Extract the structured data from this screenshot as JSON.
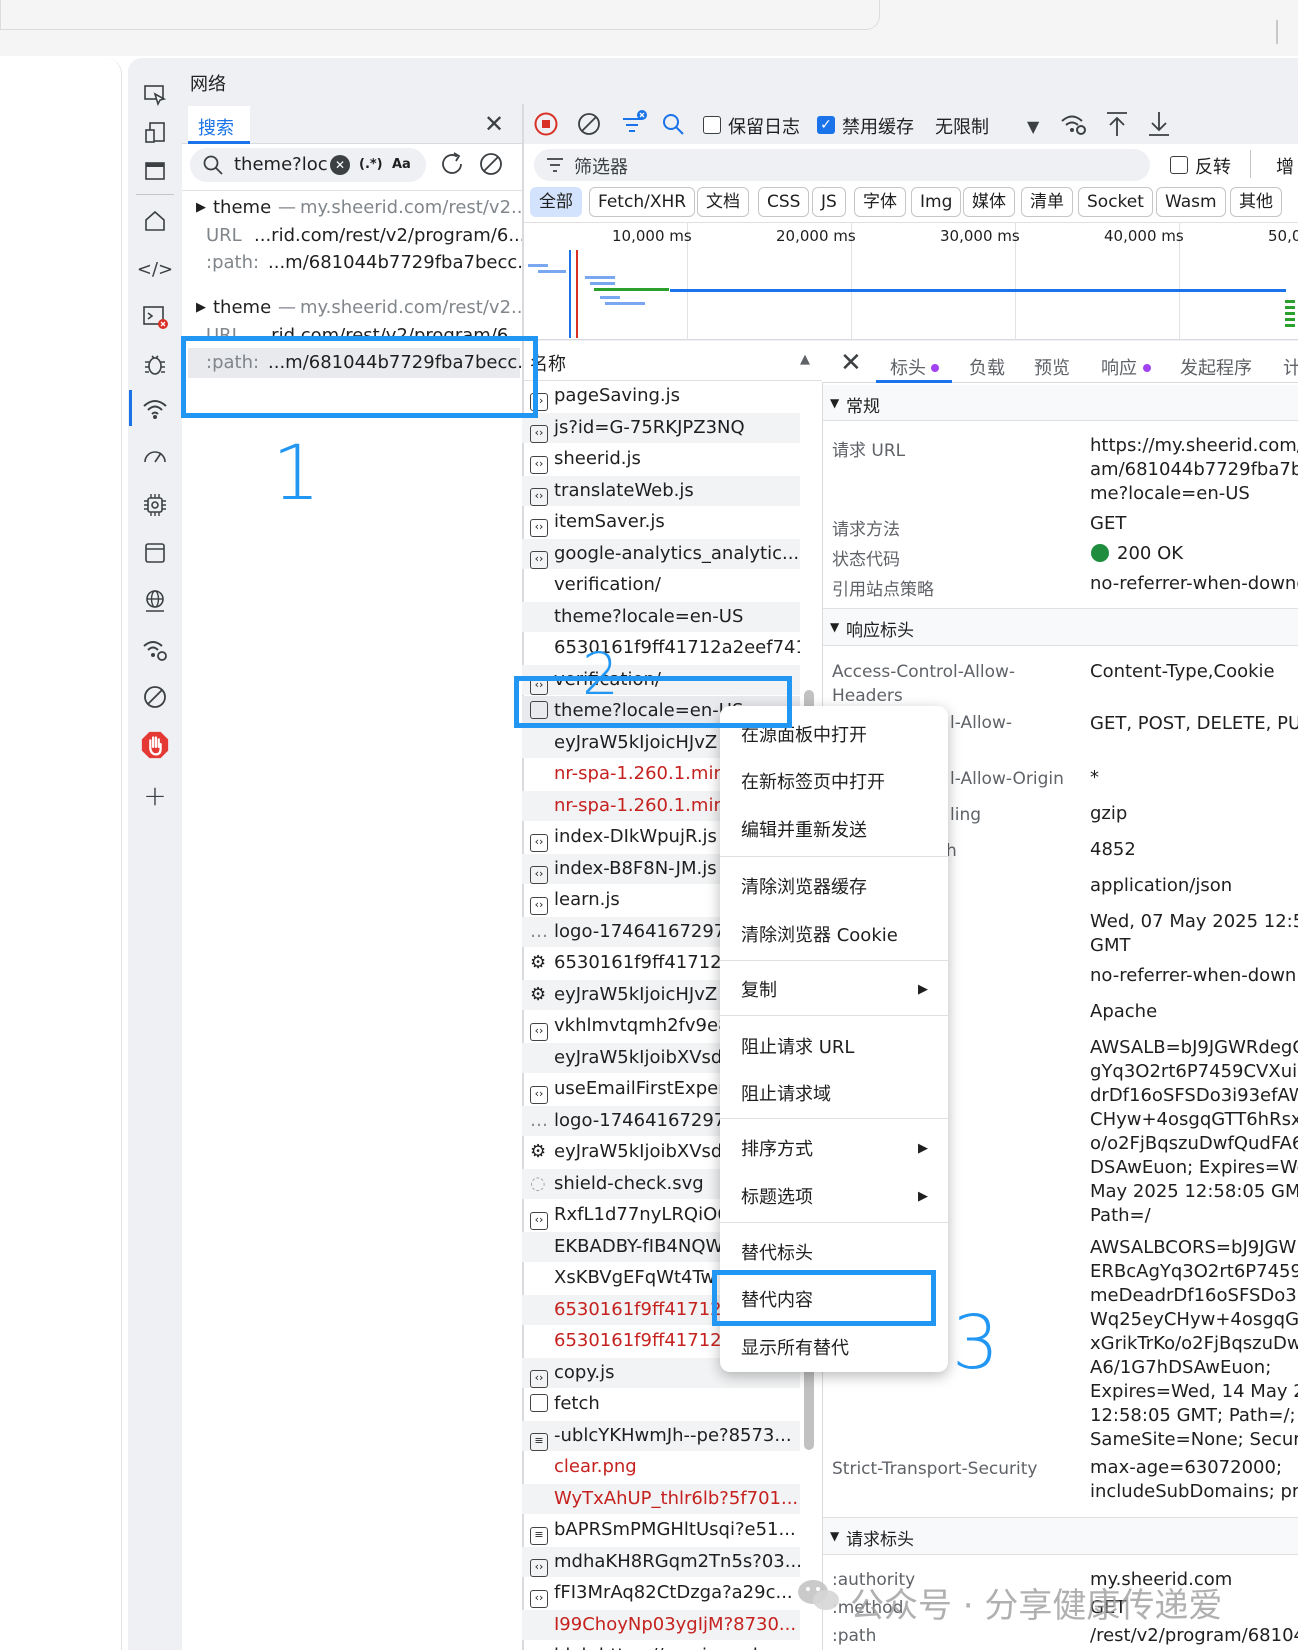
{
  "panel_title": "网络",
  "search": {
    "tab_label": "搜索",
    "query": "theme?loc",
    "regex_label": "(.*)",
    "case_label": "Aa",
    "results": [
      {
        "name": "theme",
        "source": "my.sheerid.com/rest/v2...",
        "url_label": "URL",
        "url_value": "...rid.com/rest/v2/program/6...",
        "path_label": ":path:",
        "path_value": "...m/681044b7729fba7becc..."
      },
      {
        "name": "theme",
        "source": "my.sheerid.com/rest/v2...",
        "url_label": "URL",
        "url_value": "...rid.com/rest/v2/program/6...",
        "path_label": ":path:",
        "path_value": "...m/681044b7729fba7becc..."
      }
    ]
  },
  "toolbar": {
    "preserve_log": "保留日志",
    "disable_cache": "禁用缓存",
    "throttle": "无限制",
    "invert": "反转",
    "more": "增"
  },
  "filter": {
    "placeholder": "筛选器",
    "chips": [
      "全部",
      "Fetch/XHR",
      "文档",
      "CSS",
      "JS",
      "字体",
      "Img",
      "媒体",
      "清单",
      "Socket",
      "Wasm",
      "其他"
    ]
  },
  "timeline": {
    "ticks": [
      "10,000 ms",
      "20,000 ms",
      "30,000 ms",
      "40,000 ms",
      "50,0"
    ]
  },
  "request_list": {
    "header": "名称",
    "rows": [
      {
        "name": "pageSaving.js",
        "color": "normal"
      },
      {
        "name": "js?id=G-75RKJPZ3NQ",
        "color": "normal"
      },
      {
        "name": "sheerid.js",
        "color": "normal"
      },
      {
        "name": "translateWeb.js",
        "color": "normal"
      },
      {
        "name": "itemSaver.js",
        "color": "normal"
      },
      {
        "name": "google-analytics_analytic...",
        "color": "normal"
      },
      {
        "name": "verification/",
        "color": "normal"
      },
      {
        "name": "theme?locale=en-US",
        "color": "normal"
      },
      {
        "name": "6530161f9ff41712a2eef741",
        "color": "normal"
      },
      {
        "name": "verification/",
        "color": "normal"
      },
      {
        "name": "theme?locale=en-US",
        "color": "normal"
      },
      {
        "name": "eyJraW5kIjoicHJvZ",
        "color": "normal"
      },
      {
        "name": "nr-spa-1.260.1.min.",
        "color": "red"
      },
      {
        "name": "nr-spa-1.260.1.min.",
        "color": "red"
      },
      {
        "name": "index-DIkWpujR.js",
        "color": "normal"
      },
      {
        "name": "index-B8F8N-JM.js",
        "color": "normal"
      },
      {
        "name": "learn.js",
        "color": "normal"
      },
      {
        "name": "logo-17464167297",
        "color": "normal"
      },
      {
        "name": "6530161f9ff41712a",
        "color": "normal"
      },
      {
        "name": "eyJraW5kIjoicHJvZ",
        "color": "normal"
      },
      {
        "name": "vkhlmvtqmh2fv9e8",
        "color": "normal"
      },
      {
        "name": "eyJraW5kIjoibXVsd",
        "color": "normal"
      },
      {
        "name": "useEmailFirstExperi",
        "color": "normal"
      },
      {
        "name": "logo-17464167297",
        "color": "normal"
      },
      {
        "name": "eyJraW5kIjoibXVsd",
        "color": "normal"
      },
      {
        "name": "shield-check.svg",
        "color": "normal"
      },
      {
        "name": "RxfL1d77nyLRQiO6",
        "color": "normal"
      },
      {
        "name": "EKBADBY-fIB4NQW",
        "color": "normal"
      },
      {
        "name": "XsKBVgEFqWt4Tw",
        "color": "normal"
      },
      {
        "name": "6530161f9ff41712a",
        "color": "red"
      },
      {
        "name": "6530161f9ff41712a",
        "color": "red"
      },
      {
        "name": "copy.js",
        "color": "normal"
      },
      {
        "name": "fetch",
        "color": "normal"
      },
      {
        "name": "-ublcYKHwmJh--pe?8573...",
        "color": "normal"
      },
      {
        "name": "clear.png",
        "color": "red"
      },
      {
        "name": "WyTxAhUP_thlr6lb?5f701...",
        "color": "red"
      },
      {
        "name": "bAPRSmPMGHltUsqi?e51...",
        "color": "normal"
      },
      {
        "name": "mdhaKH8RGqm2Tn5s?03...",
        "color": "normal"
      },
      {
        "name": "fFI3MrAq82CtDzga?a29c...",
        "color": "normal"
      },
      {
        "name": "I99ChoyNp03ygIjM?8730...",
        "color": "red"
      },
      {
        "name": "blob:https://services.chee",
        "color": "normal"
      }
    ]
  },
  "context_menu": {
    "items": [
      "在源面板中打开",
      "在新标签页中打开",
      "编辑并重新发送",
      "清除浏览器缓存",
      "清除浏览器 Cookie",
      "复制",
      "阻止请求 URL",
      "阻止请求域",
      "排序方式",
      "标题选项",
      "替代标头",
      "替代内容",
      "显示所有替代"
    ]
  },
  "details": {
    "tabs": [
      "标头",
      "负载",
      "预览",
      "响应",
      "发起程序",
      "计"
    ],
    "general": {
      "title": "常规",
      "request_url_label": "请求 URL",
      "request_url_lines": [
        "https://my.sheerid.com/r",
        "am/681044b7729fba7be",
        "me?locale=en-US"
      ],
      "method_label": "请求方法",
      "method": "GET",
      "status_label": "状态代码",
      "status": "200 OK",
      "referrer_label": "引用站点策略",
      "referrer": "no-referrer-when-downg"
    },
    "response_headers": {
      "title": "响应标头",
      "k1a": "Access-Control-Allow-",
      "k1b": "Headers",
      "v1": "Content-Type,Cookie",
      "k2": "l-Allow-",
      "v2": "GET, POST, DELETE, PUT",
      "k3": "l-Allow-Origin",
      "v3": "*",
      "k4": "ling",
      "v4": "gzip",
      "k5": "h",
      "v5": "4852",
      "v6": "application/json",
      "v7a": "Wed, 07 May 2025 12:58",
      "v7b": "GMT",
      "v8": "no-referrer-when-down",
      "v9": "Apache",
      "v10": [
        "AWSALB=bJ9JGWRdegC",
        "gYq3O2rt6P7459CVXuirn",
        "drDf16oSFSDo3i93efAW",
        "CHyw+4osgqGTT6hRsxC",
        "o/o2FjBqszuDwfQudFA6",
        "DSAwEuon; Expires=Wed",
        "May 2025 12:58:05 GMT",
        "Path=/"
      ],
      "v11": [
        "AWSALBCORS=bJ9JGWR",
        "ERBcAgYq3O2rt6P7459C",
        "meDeadrDf16oSFSDo3i9",
        "Wq25eyCHyw+4osgqGT",
        "xGrikTrKo/o2FjBqszuDw",
        "A6/1G7hDSAwEuon;",
        "Expires=Wed, 14 May 20",
        "12:58:05 GMT; Path=/;",
        "SameSite=None; Secure"
      ],
      "k12": "Strict-Transport-Security",
      "v12": [
        "max-age=63072000;",
        "includeSubDomains; pre"
      ]
    },
    "request_headers": {
      "title": "请求标头",
      "k1": ":authority",
      "v1": "my.sheerid.com",
      "k2": ":method",
      "v2": "GET",
      "k3": ":path",
      "v3": "/rest/v2/program/68104"
    }
  },
  "annotations": [
    "1",
    "2",
    "3"
  ],
  "watermark": "公众号 · 分享健康传递爱"
}
